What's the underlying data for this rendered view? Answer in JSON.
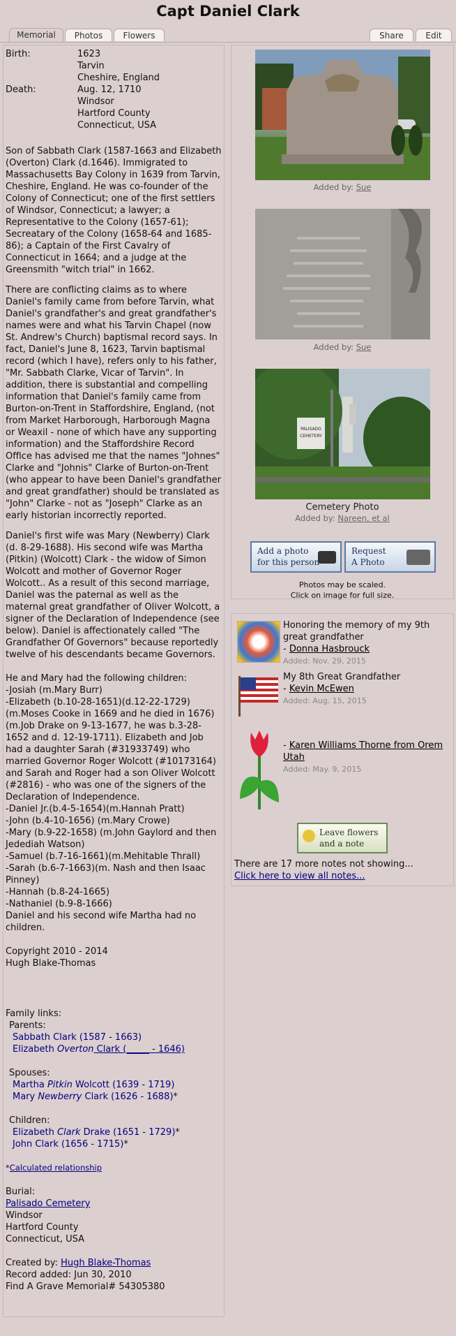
{
  "page": {
    "title": "Capt Daniel Clark"
  },
  "tabs": {
    "memorial": "Memorial",
    "photos": "Photos",
    "flowers": "Flowers",
    "share": "Share",
    "edit": "Edit"
  },
  "facts": {
    "birth_label": "Birth:",
    "birth_year": "1623",
    "birth_place1": "Tarvin",
    "birth_place2": "Cheshire, England",
    "death_label": "Death:",
    "death_date": "Aug. 12, 1710",
    "death_place1": "Windsor",
    "death_place2": "Hartford County",
    "death_place3": "Connecticut, USA"
  },
  "bio": {
    "p1": "Son of Sabbath Clark (1587-1663 and Elizabeth (Overton) Clark (d.1646). Immigrated to Massachusetts Bay Colony in 1639 from Tarvin, Cheshire, England. He was co-founder of the Colony of Connecticut; one of the first settlers of Windsor, Connecticut; a lawyer; a Representative to the Colony (1657-61); Secreatary of the Colony (1658-64 and 1685-86); a Captain of the First Cavalry of Connecticut in 1664; and a judge at the Greensmith \"witch trial\" in 1662.",
    "p2": "There are conflicting claims as to where Daniel's family came from before Tarvin, what Daniel's grandfather's and great grandfather's names were and what his Tarvin Chapel (now St. Andrew's Church) baptismal record says. In fact, Daniel's June 8, 1623, Tarvin baptismal record (which I have), refers only to his father, \"Mr. Sabbath Clarke, Vicar of Tarvin\". In addition, there is substantial and compelling information that Daniel's family came from Burton-on-Trent in Staffordshire, England, (not from Market Harborough, Harborough Magna or Weaxil - none of which have any supporting information) and the Staffordshire Record Office has advised me that the names \"Johnes\" Clarke and \"Johnis\" Clarke of Burton-on-Trent (who appear to have been Daniel's grandfather and great grandfather) should be translated as \"John\" Clarke - not as \"Joseph\" Clarke as an early historian incorrectly reported.",
    "p3": "Daniel's first wife was Mary (Newberry) Clark (d. 8-29-1688). His second wife was Martha (Pitkin) (Wolcott) Clark - the widow of Simon Wolcott and mother of Governor Roger Wolcott.. As a result of this second marriage, Daniel was the paternal as well as the maternal great grandfather of Oliver Wolcott, a signer of the Declaration of Independence (see below). Daniel is affectionately called \"The Grandfather Of Governors\" because reportedly twelve of his descendants became Governors.",
    "children_intro": "He and Mary had the following children:",
    "children": [
      "-Josiah (m.Mary Burr)",
      "-Elizabeth (b.10-28-1651)(d.12-22-1729) (m.Moses Cooke in 1669 and he died in 1676) (m.Job Drake on 9-13-1677, he was b.3-28-1652 and d. 12-19-1711). Elizabeth and Job had a daughter Sarah (#31933749) who married Governor Roger Wolcott (#10173164) and Sarah and Roger had a son Oliver Wolcott (#2816) - who was one of the signers of the Declaration of Independence.",
      "-Daniel Jr.(b.4-5-1654)(m.Hannah Pratt)",
      "-John (b.4-10-1656) (m.Mary Crowe)",
      "-Mary (b.9-22-1658) (m.John Gaylord and then Jedediah Watson)",
      "-Samuel (b.7-16-1661)(m.Mehitable Thrall)",
      "-Sarah (b.6-7-1663)(m. Nash and then Isaac Pinney)",
      "-Hannah (b.8-24-1665)",
      "-Nathaniel (b.9-8-1666)"
    ],
    "children_outro": "Daniel and his second wife Martha had no children.",
    "copyright": "Copyright 2010 - 2014",
    "author": "Hugh Blake-Thomas"
  },
  "family": {
    "heading": "Family links:",
    "parents_label": "Parents:",
    "parent1": "Sabbath Clark (1587 - 1663)",
    "parent2_a": "Elizabeth ",
    "parent2_b": "Overton",
    "parent2_c": " Clark (_____ - 1646)",
    "spouses_label": "Spouses:",
    "spouse1_a": "Martha ",
    "spouse1_b": "Pitkin",
    "spouse1_c": " Wolcott (1639 - 1719)",
    "spouse2_a": "Mary ",
    "spouse2_b": "Newberry",
    "spouse2_c": " Clark (1626 - 1688)",
    "spouse2_star": "*",
    "children_label": "Children:",
    "child1_a": "Elizabeth ",
    "child1_b": "Clark",
    "child1_c": " Drake (1651 - 1729)",
    "child1_star": "*",
    "child2": "John Clark (1656 - 1715)",
    "child2_star": "*",
    "calc_star": "*",
    "calc_link": "Calculated relationship"
  },
  "burial": {
    "label": "Burial:",
    "cemetery": "Palisado Cemetery",
    "city": "Windsor",
    "county": "Hartford County",
    "country": "Connecticut, USA"
  },
  "record": {
    "created_label": "Created by: ",
    "created_by": "Hugh Blake-Thomas",
    "added": "Record added: Jun 30, 2010",
    "memorial": "Find A Grave Memorial# 54305380"
  },
  "photos": {
    "added_by_label": "Added by: ",
    "photo1_by": "Sue",
    "photo2_by": "Sue",
    "photo3_caption": "Cemetery Photo",
    "photo3_by": "Nareen, et al",
    "photo3_sign": "PALISADO CEMETERY",
    "add_photo_l1": "Add a photo",
    "add_photo_l2": "for this person",
    "request_l1": "Request",
    "request_l2": "A Photo",
    "scaled_note": "Photos may be scaled.",
    "click_note": "Click on image for full size."
  },
  "notes": {
    "items": [
      {
        "text": "Honoring the memory of my 9th great grandfather",
        "author": "Donna Hasbrouck",
        "date": "Added: Nov. 29, 2015"
      },
      {
        "text": "My 8th Great Grandfather",
        "author": "Kevin McEwen",
        "date": "Added: Aug. 15, 2015"
      },
      {
        "text": "",
        "author": "Karen Williams Thorne from Orem Utah",
        "date": "Added: May. 9, 2015"
      }
    ],
    "leave_l1": "Leave flowers",
    "leave_l2": "and a note",
    "more": "There are 17 more notes not showing...",
    "view_all": "Click here to view all notes..."
  },
  "colors": {
    "background": "#dccfcf",
    "link": "#000080",
    "border": "#c6b8b8"
  }
}
